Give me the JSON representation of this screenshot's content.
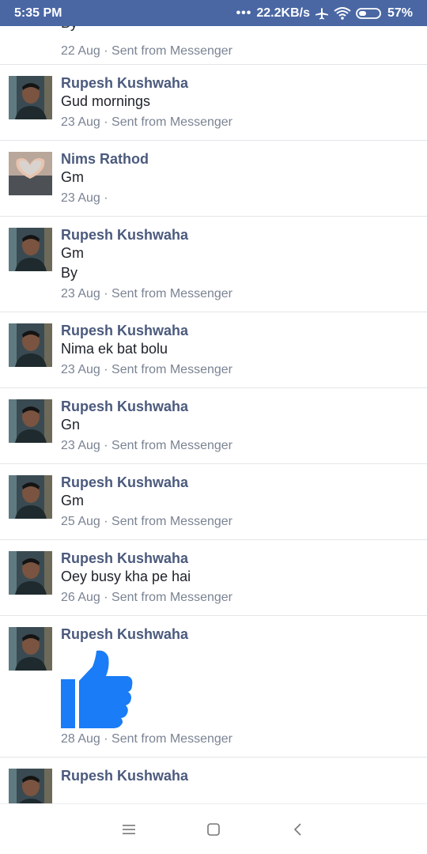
{
  "status_bar": {
    "time": "5:35 PM",
    "net_speed": "22.2KB/s",
    "battery": "57%"
  },
  "messages": {
    "partial": {
      "text": "By",
      "meta": "22 Aug · Sent from Messenger"
    },
    "items": [
      {
        "name": "Rupesh Kushwaha",
        "lines": [
          "Gud mornings"
        ],
        "meta": "23 Aug · Sent from Messenger",
        "avatar": "man-avatar"
      },
      {
        "name": "Nims Rathod",
        "lines": [
          "Gm"
        ],
        "meta": "23 Aug ·",
        "avatar": "hands-heart-avatar"
      },
      {
        "name": "Rupesh Kushwaha",
        "lines": [
          "Gm",
          "By"
        ],
        "meta": "23 Aug · Sent from Messenger",
        "avatar": "man-avatar"
      },
      {
        "name": "Rupesh Kushwaha",
        "lines": [
          "Nima ek bat bolu"
        ],
        "meta": "23 Aug · Sent from Messenger",
        "avatar": "man-avatar"
      },
      {
        "name": "Rupesh Kushwaha",
        "lines": [
          "Gn"
        ],
        "meta": "23 Aug · Sent from Messenger",
        "avatar": "man-avatar"
      },
      {
        "name": "Rupesh Kushwaha",
        "lines": [
          "Gm"
        ],
        "meta": "25 Aug · Sent from Messenger",
        "avatar": "man-avatar"
      },
      {
        "name": "Rupesh Kushwaha",
        "lines": [
          "Oey busy kha pe hai"
        ],
        "meta": "26 Aug · Sent from Messenger",
        "avatar": "man-avatar"
      },
      {
        "name": "Rupesh Kushwaha",
        "lines": [],
        "sticker": "thumbs-up-icon",
        "meta": "28 Aug · Sent from Messenger",
        "avatar": "man-avatar"
      },
      {
        "name": "Rupesh Kushwaha",
        "lines": [],
        "meta": "",
        "avatar": "man-avatar"
      }
    ]
  },
  "colors": {
    "status_bar": "#4a67a4",
    "name": "#4b5a7d",
    "like_blue": "#1a7cf6"
  }
}
